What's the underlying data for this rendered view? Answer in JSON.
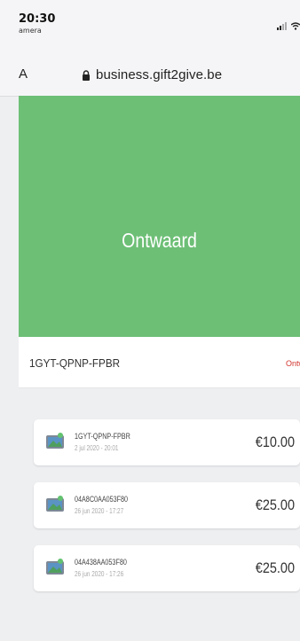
{
  "status_bar": {
    "time": "20:30",
    "back_app": "amera"
  },
  "browser": {
    "text_size_button": "A",
    "url": "business.gift2give.be"
  },
  "hero": {
    "title": "Ontwaard"
  },
  "card": {
    "code": "1GYT-QPNP-FPBR",
    "status": "Ontwaard"
  },
  "transactions": [
    {
      "code": "1GYT-QPNP-FPBR",
      "date": "2 jul 2020 - 20:01",
      "amount": "€10.00",
      "icon": "gift-card-thumbnail-icon"
    },
    {
      "code": "04A8C0AA053F80",
      "date": "26 jun 2020 - 17:27",
      "amount": "€25.00",
      "icon": "gift-card-thumbnail-icon"
    },
    {
      "code": "04A438AA053F80",
      "date": "26 jun 2020 - 17:26",
      "amount": "€25.00",
      "icon": "gift-card-thumbnail-icon"
    }
  ],
  "colors": {
    "hero_green": "#6dbf76",
    "status_red": "#d2342e",
    "background": "#eeeff1"
  }
}
